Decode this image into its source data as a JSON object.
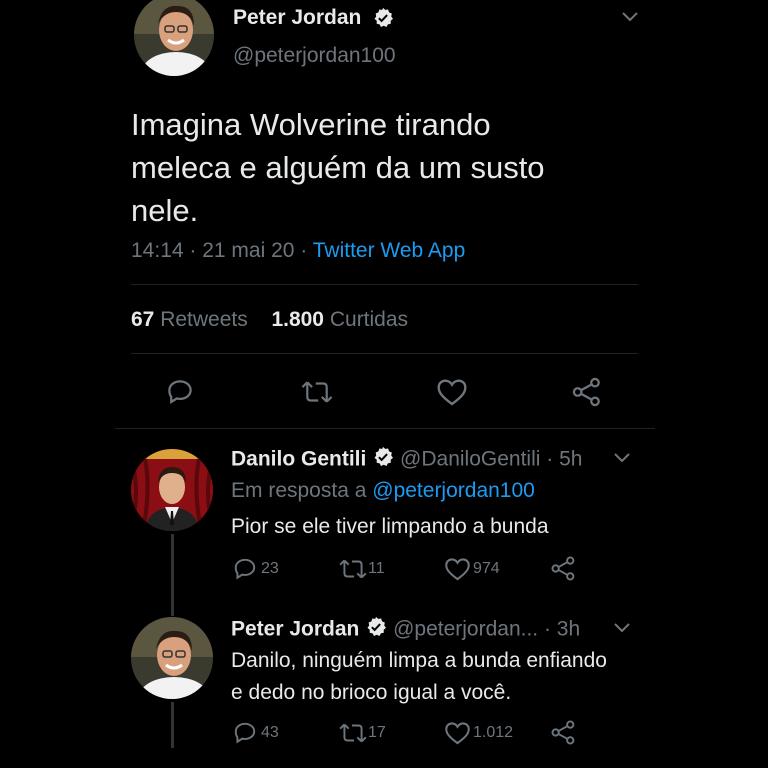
{
  "main_tweet": {
    "author_name": "Peter Jordan",
    "handle": "@peterjordan100",
    "text_lines": [
      "Imagina Wolverine tirando",
      "meleca e alguém da um susto",
      "nele."
    ],
    "timestamp": "14:14 · 21 mai 20 · ",
    "source": "Twitter Web App",
    "retweets_count": "67",
    "retweets_label": "Retweets",
    "likes_count": "1.800",
    "likes_label": "Curtidas"
  },
  "replies": [
    {
      "author_name": "Danilo Gentili",
      "handle_time": "@DaniloGentili · 5h",
      "reply_to_prefix": "Em resposta a",
      "reply_to_handle": "@peterjordan100",
      "text_lines": [
        "Pior se ele tiver limpando a bunda"
      ],
      "reply_count": "23",
      "retweet_count": "11",
      "like_count": "974"
    },
    {
      "author_name": "Peter Jordan",
      "handle_time": "@peterjordan... · 3h",
      "text_lines": [
        "Danilo, ninguém limpa a bunda enfiando",
        "e dedo no brioco igual a você."
      ],
      "reply_count": "43",
      "retweet_count": "17",
      "like_count": "1.012"
    }
  ],
  "icons": {
    "reply": "reply-icon",
    "retweet": "retweet-icon",
    "like": "heart-icon",
    "share": "share-icon",
    "verified": "verified-badge-icon",
    "more": "chevron-down-icon"
  },
  "colors": {
    "background": "#000000",
    "text": "#e7e9ea",
    "muted": "#6e767d",
    "link": "#1d9bf0"
  }
}
